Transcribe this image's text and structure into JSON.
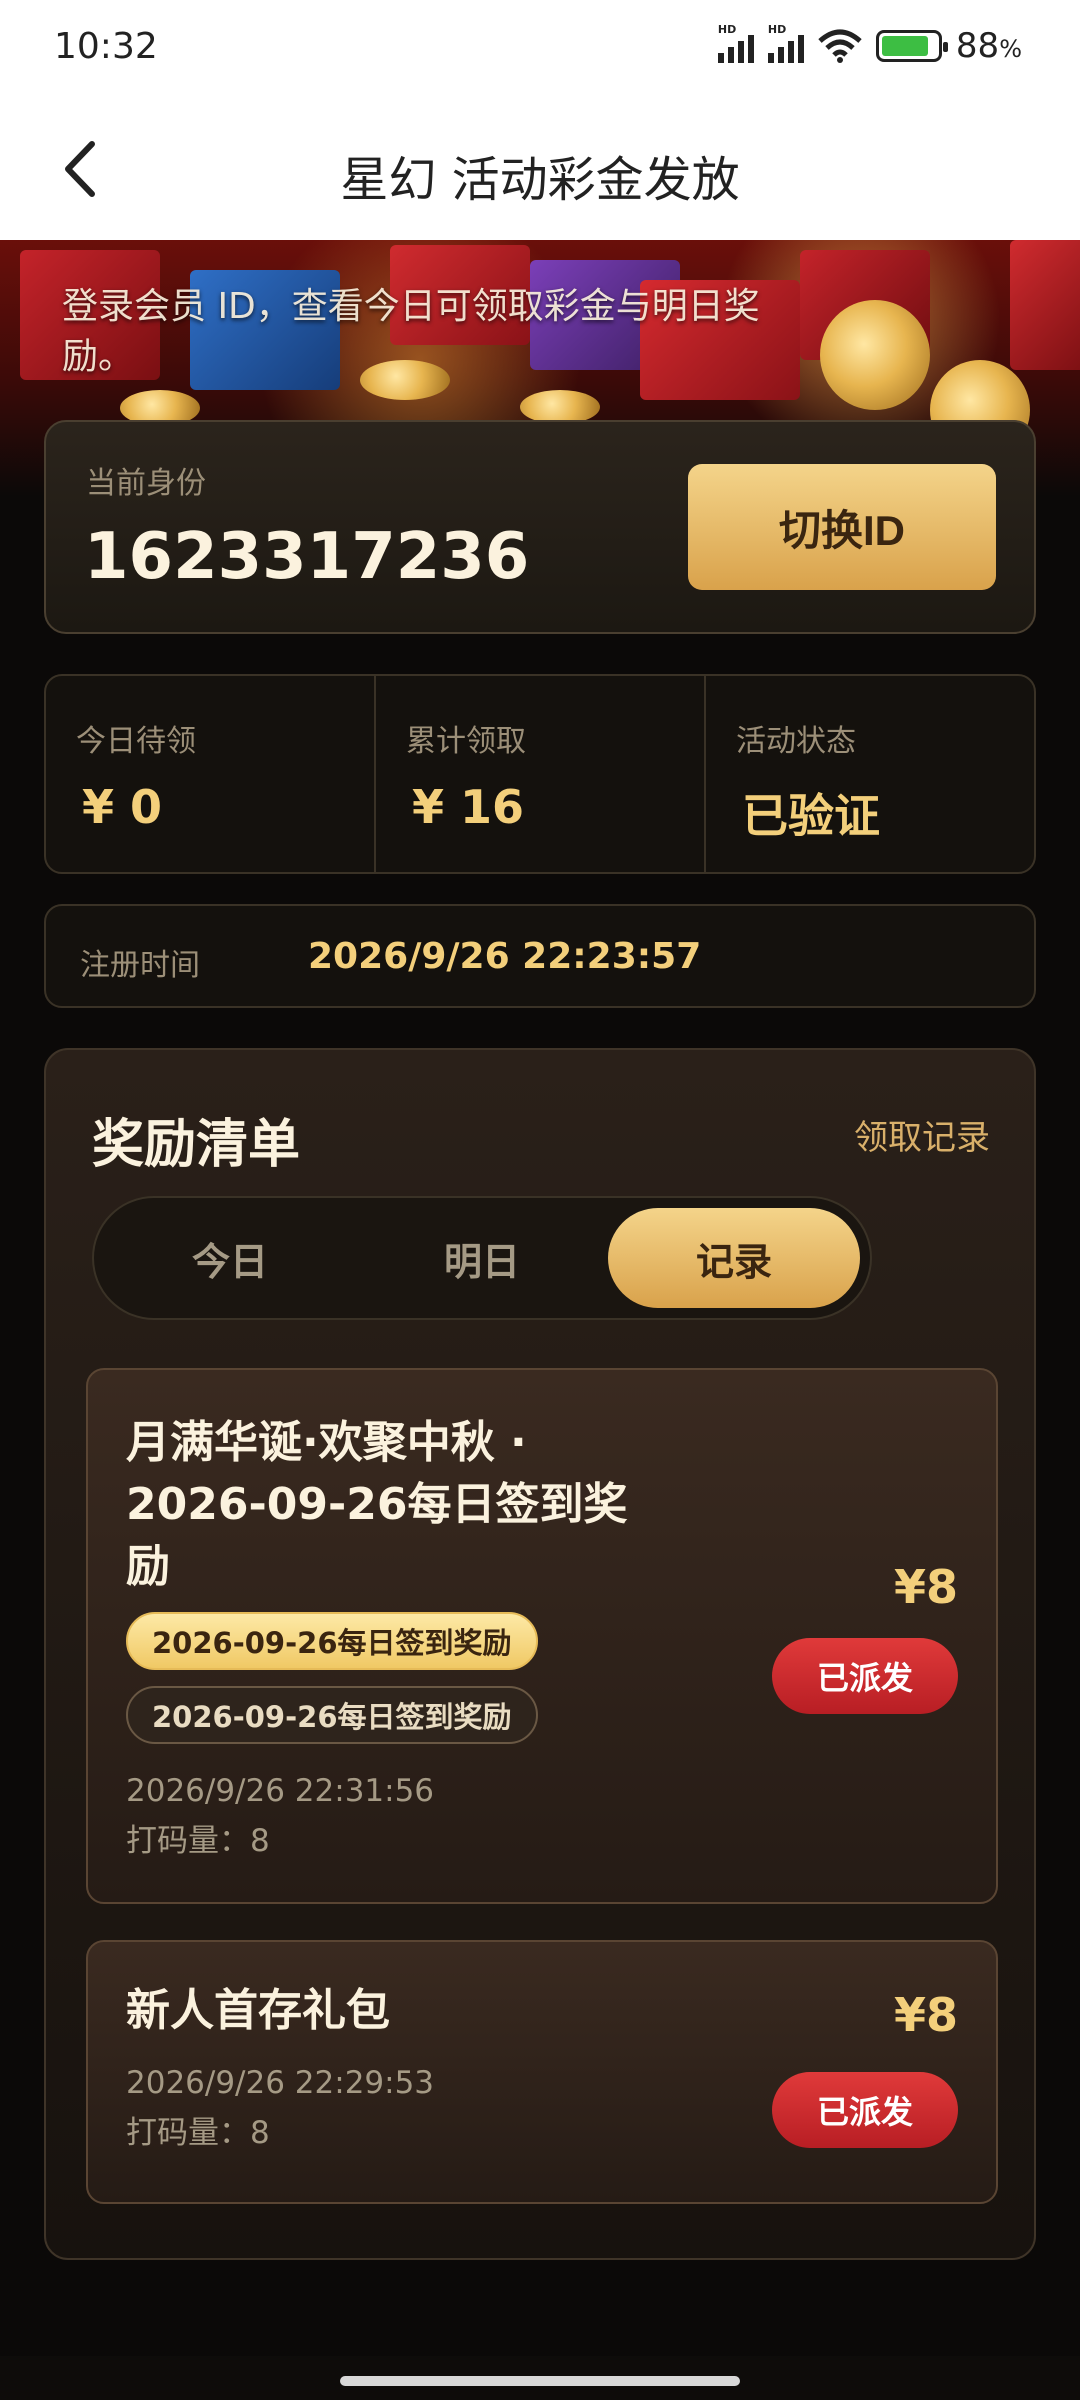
{
  "status_bar": {
    "time": "10:32",
    "signal_1_label": "HD",
    "signal_2_label": "HD",
    "battery_percent": "88",
    "battery_unit": "%"
  },
  "header": {
    "title": "星幻 活动彩金发放",
    "back_icon": "chevron-left-icon"
  },
  "banner": {
    "text": "登录会员 ID，查看今日可领取彩金与明日奖励。"
  },
  "identity": {
    "label": "当前身份",
    "member_id": "1623317236",
    "switch_button": "切换ID"
  },
  "stats": [
    {
      "label": "今日待领",
      "value": "¥ 0"
    },
    {
      "label": "累计领取",
      "value": "¥ 16"
    },
    {
      "label": "活动状态",
      "value": "已验证"
    }
  ],
  "registration": {
    "label": "注册时间",
    "value": "2026/9/26 22:23:57"
  },
  "rewards": {
    "title": "奖励清单",
    "history_link": "领取记录",
    "tabs": [
      {
        "label": "今日",
        "active": false
      },
      {
        "label": "明日",
        "active": false
      },
      {
        "label": "记录",
        "active": true
      }
    ],
    "records": [
      {
        "title": "月满华诞·欢聚中秋 · 2026-09-26每日签到奖励",
        "amount": "¥8",
        "status": "已派发",
        "tags": [
          "2026-09-26每日签到奖励",
          "2026-09-26每日签到奖励"
        ],
        "time": "2026/9/26 22:31:56",
        "wager": "打码量：8"
      },
      {
        "title": "新人首存礼包",
        "amount": "¥8",
        "status": "已派发",
        "tags": [],
        "time": "2026/9/26 22:29:53",
        "wager": "打码量：8"
      }
    ]
  },
  "colors": {
    "background": "#0b0908",
    "gold_accent": "#f3cf7b",
    "gold_button": "#d9a24b",
    "status_red": "#c8262c"
  }
}
